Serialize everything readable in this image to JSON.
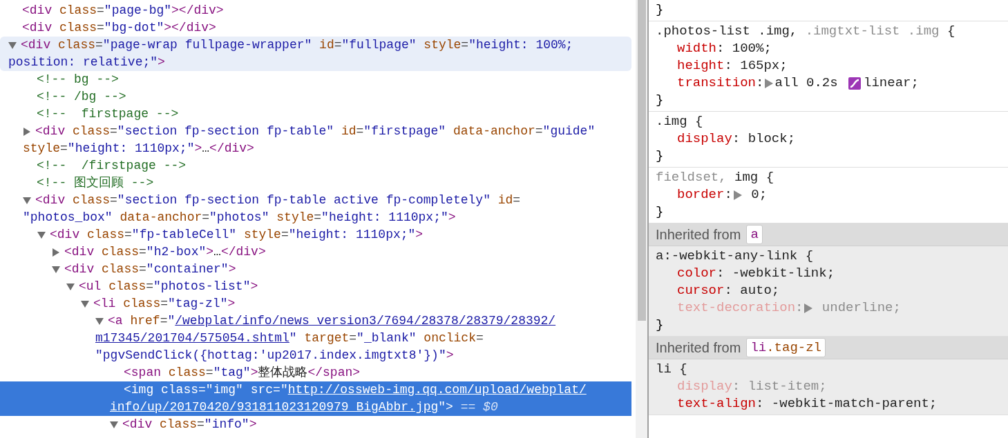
{
  "elements_panel": {
    "nodes": [
      {
        "selected": false,
        "hovered": false,
        "lines": [
          [
            {
              "kind": "tag",
              "text": "<div"
            },
            {
              "kind": "attr",
              "text": " class"
            },
            {
              "kind": "punct",
              "text": "="
            },
            {
              "kind": "value",
              "text": "\"page-bg\""
            },
            {
              "kind": "tag",
              "text": "></div>"
            }
          ]
        ]
      },
      {
        "selected": false,
        "hovered": false,
        "lines": [
          [
            {
              "kind": "tag",
              "text": "<div"
            },
            {
              "kind": "attr",
              "text": " class"
            },
            {
              "kind": "punct",
              "text": "="
            },
            {
              "kind": "value",
              "text": "\"bg-dot\""
            },
            {
              "kind": "tag",
              "text": "></div>"
            }
          ]
        ]
      },
      {
        "expanded": true,
        "selected": false,
        "hovered": true,
        "lines": [
          [
            {
              "kind": "tag",
              "text": "<div"
            },
            {
              "kind": "attr",
              "text": " class"
            },
            {
              "kind": "punct",
              "text": "="
            },
            {
              "kind": "value",
              "text": "\"page-wrap fullpage-wrapper\""
            },
            {
              "kind": "attr",
              "text": " id"
            },
            {
              "kind": "punct",
              "text": "="
            },
            {
              "kind": "value",
              "text": "\"fullpage\""
            },
            {
              "kind": "attr",
              "text": " style"
            },
            {
              "kind": "punct",
              "text": "="
            },
            {
              "kind": "value",
              "text": "\"height: 100%;"
            }
          ],
          [
            {
              "kind": "value",
              "text": "position: relative;\""
            },
            {
              "kind": "tag",
              "text": ">"
            }
          ]
        ],
        "children": [
          {
            "selected": false,
            "hovered": false,
            "lines": [
              [
                {
                  "kind": "comment",
                  "text": "<!-- bg -->"
                }
              ]
            ]
          },
          {
            "selected": false,
            "hovered": false,
            "lines": [
              [
                {
                  "kind": "comment",
                  "text": "<!-- /bg -->"
                }
              ]
            ]
          },
          {
            "selected": false,
            "hovered": false,
            "lines": [
              [
                {
                  "kind": "comment",
                  "text": "<!--  firstpage -->"
                }
              ]
            ]
          },
          {
            "expanded": false,
            "selected": false,
            "hovered": false,
            "lines": [
              [
                {
                  "kind": "tag",
                  "text": "<div"
                },
                {
                  "kind": "attr",
                  "text": " class"
                },
                {
                  "kind": "punct",
                  "text": "="
                },
                {
                  "kind": "value",
                  "text": "\"section fp-section fp-table\""
                },
                {
                  "kind": "attr",
                  "text": " id"
                },
                {
                  "kind": "punct",
                  "text": "="
                },
                {
                  "kind": "value",
                  "text": "\"firstpage\""
                },
                {
                  "kind": "attr",
                  "text": " data-anchor"
                },
                {
                  "kind": "punct",
                  "text": "="
                },
                {
                  "kind": "value",
                  "text": "\"guide\""
                }
              ],
              [
                {
                  "kind": "attr",
                  "text": "style"
                },
                {
                  "kind": "punct",
                  "text": "="
                },
                {
                  "kind": "value",
                  "text": "\"height: 1110px;\""
                },
                {
                  "kind": "tag",
                  "text": ">"
                },
                {
                  "kind": "text",
                  "text": "…"
                },
                {
                  "kind": "tag",
                  "text": "</div>"
                }
              ]
            ]
          },
          {
            "selected": false,
            "hovered": false,
            "lines": [
              [
                {
                  "kind": "comment",
                  "text": "<!--  /firstpage -->"
                }
              ]
            ]
          },
          {
            "selected": false,
            "hovered": false,
            "lines": [
              [
                {
                  "kind": "comment",
                  "text": "<!-- 图文回顾 -->"
                }
              ]
            ]
          },
          {
            "expanded": true,
            "selected": false,
            "hovered": false,
            "lines": [
              [
                {
                  "kind": "tag",
                  "text": "<div"
                },
                {
                  "kind": "attr",
                  "text": " class"
                },
                {
                  "kind": "punct",
                  "text": "="
                },
                {
                  "kind": "value",
                  "text": "\"section fp-section fp-table active fp-completely\""
                },
                {
                  "kind": "attr",
                  "text": " id"
                },
                {
                  "kind": "punct",
                  "text": "="
                }
              ],
              [
                {
                  "kind": "value",
                  "text": "\"photos_box\""
                },
                {
                  "kind": "attr",
                  "text": " data-anchor"
                },
                {
                  "kind": "punct",
                  "text": "="
                },
                {
                  "kind": "value",
                  "text": "\"photos\""
                },
                {
                  "kind": "attr",
                  "text": " style"
                },
                {
                  "kind": "punct",
                  "text": "="
                },
                {
                  "kind": "value",
                  "text": "\"height: 1110px;\""
                },
                {
                  "kind": "tag",
                  "text": ">"
                }
              ]
            ],
            "children": [
              {
                "expanded": true,
                "selected": false,
                "hovered": false,
                "lines": [
                  [
                    {
                      "kind": "tag",
                      "text": "<div"
                    },
                    {
                      "kind": "attr",
                      "text": " class"
                    },
                    {
                      "kind": "punct",
                      "text": "="
                    },
                    {
                      "kind": "value",
                      "text": "\"fp-tableCell\""
                    },
                    {
                      "kind": "attr",
                      "text": " style"
                    },
                    {
                      "kind": "punct",
                      "text": "="
                    },
                    {
                      "kind": "value",
                      "text": "\"height: 1110px;\""
                    },
                    {
                      "kind": "tag",
                      "text": ">"
                    }
                  ]
                ],
                "children": [
                  {
                    "expanded": false,
                    "selected": false,
                    "hovered": false,
                    "lines": [
                      [
                        {
                          "kind": "tag",
                          "text": "<div"
                        },
                        {
                          "kind": "attr",
                          "text": " class"
                        },
                        {
                          "kind": "punct",
                          "text": "="
                        },
                        {
                          "kind": "value",
                          "text": "\"h2-box\""
                        },
                        {
                          "kind": "tag",
                          "text": ">"
                        },
                        {
                          "kind": "text",
                          "text": "…"
                        },
                        {
                          "kind": "tag",
                          "text": "</div>"
                        }
                      ]
                    ]
                  },
                  {
                    "expanded": true,
                    "selected": false,
                    "hovered": false,
                    "lines": [
                      [
                        {
                          "kind": "tag",
                          "text": "<div"
                        },
                        {
                          "kind": "attr",
                          "text": " class"
                        },
                        {
                          "kind": "punct",
                          "text": "="
                        },
                        {
                          "kind": "value",
                          "text": "\"container\""
                        },
                        {
                          "kind": "tag",
                          "text": ">"
                        }
                      ]
                    ],
                    "children": [
                      {
                        "expanded": true,
                        "selected": false,
                        "hovered": false,
                        "lines": [
                          [
                            {
                              "kind": "tag",
                              "text": "<ul"
                            },
                            {
                              "kind": "attr",
                              "text": " class"
                            },
                            {
                              "kind": "punct",
                              "text": "="
                            },
                            {
                              "kind": "value",
                              "text": "\"photos-list\""
                            },
                            {
                              "kind": "tag",
                              "text": ">"
                            }
                          ]
                        ],
                        "children": [
                          {
                            "expanded": true,
                            "selected": false,
                            "hovered": false,
                            "lines": [
                              [
                                {
                                  "kind": "tag",
                                  "text": "<li"
                                },
                                {
                                  "kind": "attr",
                                  "text": " class"
                                },
                                {
                                  "kind": "punct",
                                  "text": "="
                                },
                                {
                                  "kind": "value",
                                  "text": "\"tag-zl\""
                                },
                                {
                                  "kind": "tag",
                                  "text": ">"
                                }
                              ]
                            ],
                            "children": [
                              {
                                "expanded": true,
                                "selected": false,
                                "hovered": false,
                                "lines": [
                                  [
                                    {
                                      "kind": "tag",
                                      "text": "<a"
                                    },
                                    {
                                      "kind": "attr",
                                      "text": " href"
                                    },
                                    {
                                      "kind": "punct",
                                      "text": "="
                                    },
                                    {
                                      "kind": "value",
                                      "text": "\""
                                    },
                                    {
                                      "kind": "link",
                                      "text": "/webplat/info/news_version3/7694/28378/28379/28392/"
                                    }
                                  ],
                                  [
                                    {
                                      "kind": "link",
                                      "text": "m17345/201704/575054.shtml"
                                    },
                                    {
                                      "kind": "value",
                                      "text": "\""
                                    },
                                    {
                                      "kind": "attr",
                                      "text": " target"
                                    },
                                    {
                                      "kind": "punct",
                                      "text": "="
                                    },
                                    {
                                      "kind": "value",
                                      "text": "\"_blank\""
                                    },
                                    {
                                      "kind": "attr",
                                      "text": " onclick"
                                    },
                                    {
                                      "kind": "punct",
                                      "text": "="
                                    }
                                  ],
                                  [
                                    {
                                      "kind": "value",
                                      "text": "\"pgvSendClick({hottag:'up2017.index.imgtxt8'})\""
                                    },
                                    {
                                      "kind": "tag",
                                      "text": ">"
                                    }
                                  ]
                                ],
                                "children": [
                                  {
                                    "selected": false,
                                    "hovered": false,
                                    "lines": [
                                      [
                                        {
                                          "kind": "tag",
                                          "text": "<span"
                                        },
                                        {
                                          "kind": "attr",
                                          "text": " class"
                                        },
                                        {
                                          "kind": "punct",
                                          "text": "="
                                        },
                                        {
                                          "kind": "value",
                                          "text": "\"tag\""
                                        },
                                        {
                                          "kind": "tag",
                                          "text": ">"
                                        },
                                        {
                                          "kind": "text",
                                          "text": "整体战略"
                                        },
                                        {
                                          "kind": "tag",
                                          "text": "</span>"
                                        }
                                      ]
                                    ]
                                  },
                                  {
                                    "selected": true,
                                    "hovered": false,
                                    "lines": [
                                      [
                                        {
                                          "kind": "tag",
                                          "text": "<img"
                                        },
                                        {
                                          "kind": "attr",
                                          "text": " class"
                                        },
                                        {
                                          "kind": "punct",
                                          "text": "="
                                        },
                                        {
                                          "kind": "value",
                                          "text": "\"img\""
                                        },
                                        {
                                          "kind": "attr",
                                          "text": " src"
                                        },
                                        {
                                          "kind": "punct",
                                          "text": "="
                                        },
                                        {
                                          "kind": "value",
                                          "text": "\""
                                        },
                                        {
                                          "kind": "link",
                                          "text": "http://ossweb-img.qq.com/upload/webplat/"
                                        }
                                      ],
                                      [
                                        {
                                          "kind": "link",
                                          "text": "info/up/20170420/931811023120979_BigAbbr.jpg"
                                        },
                                        {
                                          "kind": "value",
                                          "text": "\""
                                        },
                                        {
                                          "kind": "tag",
                                          "text": ">"
                                        },
                                        {
                                          "kind": "marker",
                                          "text": " == $0"
                                        }
                                      ]
                                    ]
                                  },
                                  {
                                    "expanded": true,
                                    "selected": false,
                                    "hovered": false,
                                    "lines": [
                                      [
                                        {
                                          "kind": "tag",
                                          "text": "<div"
                                        },
                                        {
                                          "kind": "attr",
                                          "text": " class"
                                        },
                                        {
                                          "kind": "punct",
                                          "text": "="
                                        },
                                        {
                                          "kind": "value",
                                          "text": "\"info\""
                                        },
                                        {
                                          "kind": "tag",
                                          "text": ">"
                                        }
                                      ]
                                    ]
                                  }
                                ]
                              }
                            ]
                          }
                        ]
                      }
                    ]
                  }
                ]
              }
            ]
          }
        ]
      }
    ]
  },
  "styles_panel": {
    "sections": [
      {
        "kind": "rule",
        "inherited": false,
        "close": "}"
      },
      {
        "kind": "rule",
        "inherited": false,
        "selector": [
          {
            "text": ".photos-list .img, ",
            "matched": true
          },
          {
            "text": ".imgtxt-list .img",
            "matched": false
          },
          {
            "text": " {",
            "matched": true
          }
        ],
        "properties": [
          {
            "name": "width",
            "active": true,
            "parts": [
              {
                "kind": "text",
                "text": ": 100%;"
              }
            ]
          },
          {
            "name": "height",
            "active": true,
            "parts": [
              {
                "kind": "text",
                "text": ": 165px;"
              }
            ]
          },
          {
            "name": "transition",
            "active": true,
            "parts": [
              {
                "kind": "text",
                "text": ":"
              },
              {
                "kind": "expander"
              },
              {
                "kind": "text",
                "text": "all 0.2s "
              },
              {
                "kind": "easing"
              },
              {
                "kind": "text",
                "text": "linear;"
              }
            ]
          }
        ],
        "close": "}"
      },
      {
        "kind": "rule",
        "inherited": false,
        "selector": [
          {
            "text": ".img {",
            "matched": true
          }
        ],
        "properties": [
          {
            "name": "display",
            "active": true,
            "parts": [
              {
                "kind": "text",
                "text": ": block;"
              }
            ]
          }
        ],
        "close": "}"
      },
      {
        "kind": "rule",
        "inherited": false,
        "selector": [
          {
            "text": "fieldset, ",
            "matched": false
          },
          {
            "text": "img {",
            "matched": true
          }
        ],
        "properties": [
          {
            "name": "border",
            "active": true,
            "parts": [
              {
                "kind": "text",
                "text": ":"
              },
              {
                "kind": "expander"
              },
              {
                "kind": "text",
                "text": " 0;"
              }
            ]
          }
        ],
        "close": "}"
      },
      {
        "kind": "inherited",
        "label": "Inherited from",
        "element": [
          {
            "kind": "tag",
            "text": "a"
          }
        ]
      },
      {
        "kind": "rule",
        "inherited": true,
        "selector": [
          {
            "text": "a:-webkit-any-link {",
            "matched": true
          }
        ],
        "properties": [
          {
            "name": "color",
            "active": true,
            "parts": [
              {
                "kind": "text",
                "text": ": -webkit-link;"
              }
            ]
          },
          {
            "name": "cursor",
            "active": true,
            "parts": [
              {
                "kind": "text",
                "text": ": auto;"
              }
            ]
          },
          {
            "name": "text-decoration",
            "active": false,
            "parts": [
              {
                "kind": "text",
                "text": ":"
              },
              {
                "kind": "expander"
              },
              {
                "kind": "text",
                "text": " underline;"
              }
            ]
          }
        ],
        "close": "}"
      },
      {
        "kind": "inherited",
        "label": "Inherited from",
        "element": [
          {
            "kind": "tag",
            "text": "li"
          },
          {
            "kind": "attr",
            "text": ".tag-zl"
          }
        ]
      },
      {
        "kind": "rule",
        "inherited": true,
        "selector": [
          {
            "text": "li {",
            "matched": true
          }
        ],
        "properties": [
          {
            "name": "display",
            "active": false,
            "parts": [
              {
                "kind": "text",
                "text": ": list-item;"
              }
            ]
          },
          {
            "name": "text-align",
            "active": true,
            "parts": [
              {
                "kind": "text",
                "text": ": -webkit-match-parent;"
              }
            ]
          }
        ]
      }
    ]
  }
}
